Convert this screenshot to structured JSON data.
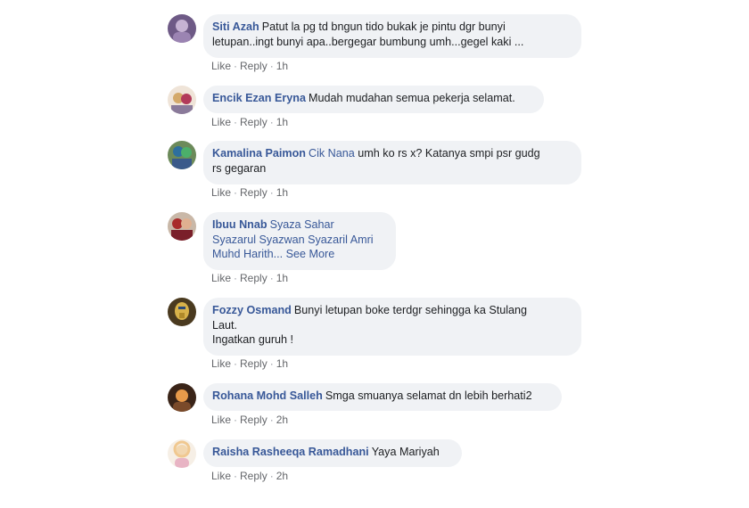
{
  "comments": [
    {
      "author": "Siti Azah",
      "lines": [
        "Patut la pg td bngun tido bukak je pintu dgr bunyi",
        "letupan..ingt bunyi apa..bergegar bumbung umh...gegel kaki ..."
      ],
      "like": "Like",
      "reply": "Reply",
      "time": "1h",
      "avatar_colors": [
        "#7b5a8c",
        "#c9b7d6"
      ]
    },
    {
      "author": "Encik Ezan Eryna",
      "text": "Mudah mudahan semua pekerja selamat.",
      "like": "Like",
      "reply": "Reply",
      "time": "1h",
      "avatar_colors": [
        "#d4a96a",
        "#b23a5a"
      ]
    },
    {
      "author": "Kamalina Paimon",
      "tag": "Cik Nana",
      "line1": "umh ko rs x? Katanya smpi psr gudg",
      "line2": "rs gegaran",
      "like": "Like",
      "reply": "Reply",
      "time": "1h",
      "avatar_colors": [
        "#2e6f9e",
        "#4caf6a"
      ]
    },
    {
      "author": "Ibuu Nnab",
      "tags_line1": "Syaza Sahar",
      "tags_line2": "Syazarul Syazwan Syazaril Amri",
      "tags_line3": "Muhd Harith...",
      "see_more": "See More",
      "like": "Like",
      "reply": "Reply",
      "time": "1h",
      "avatar_colors": [
        "#a82a2a",
        "#e0b090"
      ]
    },
    {
      "author": "Fozzy Osmand",
      "line1": "Bunyi letupan boke terdgr sehingga ka Stulang",
      "line2": "Laut.",
      "line3": "Ingatkan guruh !",
      "like": "Like",
      "reply": "Reply",
      "time": "1h",
      "avatar_colors": [
        "#5a4a2a",
        "#d8b24a"
      ]
    },
    {
      "author": "Rohana Mohd Salleh",
      "text": "Smga smuanya selamat dn lebih berhati2",
      "like": "Like",
      "reply": "Reply",
      "time": "2h",
      "avatar_colors": [
        "#7a4a2a",
        "#e89a4a"
      ]
    },
    {
      "author": "Raisha Rasheeqa Ramadhani",
      "text": "Yaya Mariyah",
      "like": "Like",
      "reply": "Reply",
      "time": "2h",
      "avatar_colors": [
        "#f2e6d8",
        "#e8b4c4"
      ]
    }
  ]
}
